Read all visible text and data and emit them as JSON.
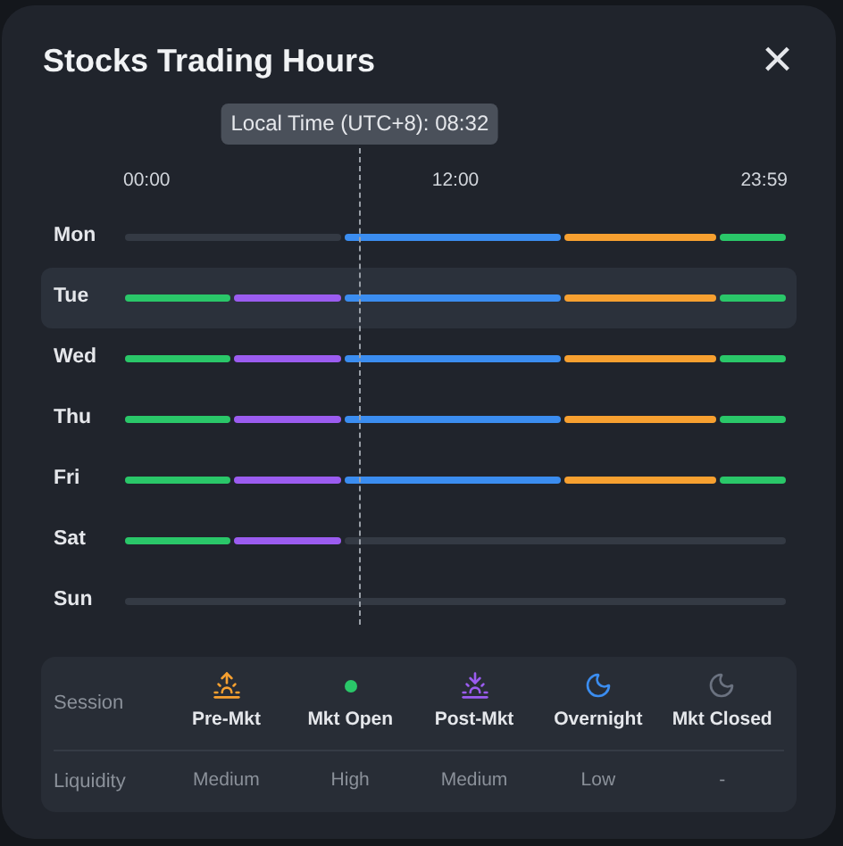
{
  "title": "Stocks Trading Hours",
  "close": "×",
  "local_time": {
    "label": "Local Time (UTC+8): 08:32"
  },
  "hour_labels": [
    "00:00",
    "12:00",
    "23:59"
  ],
  "days": [
    {
      "label": "Mon",
      "selected": false,
      "segments": [
        {
          "color": "#343a44"
        },
        {
          "color": "#3b8df0"
        },
        {
          "color": "#f7a030"
        },
        {
          "color": "#2ac769"
        }
      ]
    },
    {
      "label": "Tue",
      "selected": true,
      "segments": [
        {
          "color": "#2ac769"
        },
        {
          "color": "#9b5cf0"
        },
        {
          "color": "#3b8df0"
        },
        {
          "color": "#f7a030"
        },
        {
          "color": "#2ac769"
        }
      ]
    },
    {
      "label": "Wed",
      "selected": false,
      "segments": [
        {
          "color": "#2ac769"
        },
        {
          "color": "#9b5cf0"
        },
        {
          "color": "#3b8df0"
        },
        {
          "color": "#f7a030"
        },
        {
          "color": "#2ac769"
        }
      ]
    },
    {
      "label": "Thu",
      "selected": false,
      "segments": [
        {
          "color": "#2ac769"
        },
        {
          "color": "#9b5cf0"
        },
        {
          "color": "#3b8df0"
        },
        {
          "color": "#f7a030"
        },
        {
          "color": "#2ac769"
        }
      ]
    },
    {
      "label": "Fri",
      "selected": false,
      "segments": [
        {
          "color": "#2ac769"
        },
        {
          "color": "#9b5cf0"
        },
        {
          "color": "#3b8df0"
        },
        {
          "color": "#f7a030"
        },
        {
          "color": "#2ac769"
        }
      ]
    },
    {
      "label": "Sat",
      "selected": false,
      "segments": [
        {
          "color": "#2ac769"
        },
        {
          "color": "#9b5cf0"
        },
        {
          "color": "#343a44"
        }
      ]
    },
    {
      "label": "Sun",
      "selected": false,
      "segments": [
        {
          "color": "#343a44"
        }
      ]
    }
  ],
  "legend": {
    "session_label": "Session",
    "liquidity_label": "Liquidity",
    "sessions": [
      {
        "name": "Pre-Mkt",
        "kind": "sunrise",
        "color": "#f7a030",
        "liquidity": "Medium"
      },
      {
        "name": "Mkt Open",
        "kind": "dot",
        "color": "#2ac769",
        "liquidity": "High"
      },
      {
        "name": "Post-Mkt",
        "kind": "sunset",
        "color": "#9b5cf0",
        "liquidity": "Medium"
      },
      {
        "name": "Overnight",
        "kind": "moon",
        "color": "#3b8df0",
        "liquidity": "Low"
      },
      {
        "name": "Mkt Closed",
        "kind": "moon",
        "color": "#6b7280",
        "liquidity": "-"
      }
    ]
  }
}
